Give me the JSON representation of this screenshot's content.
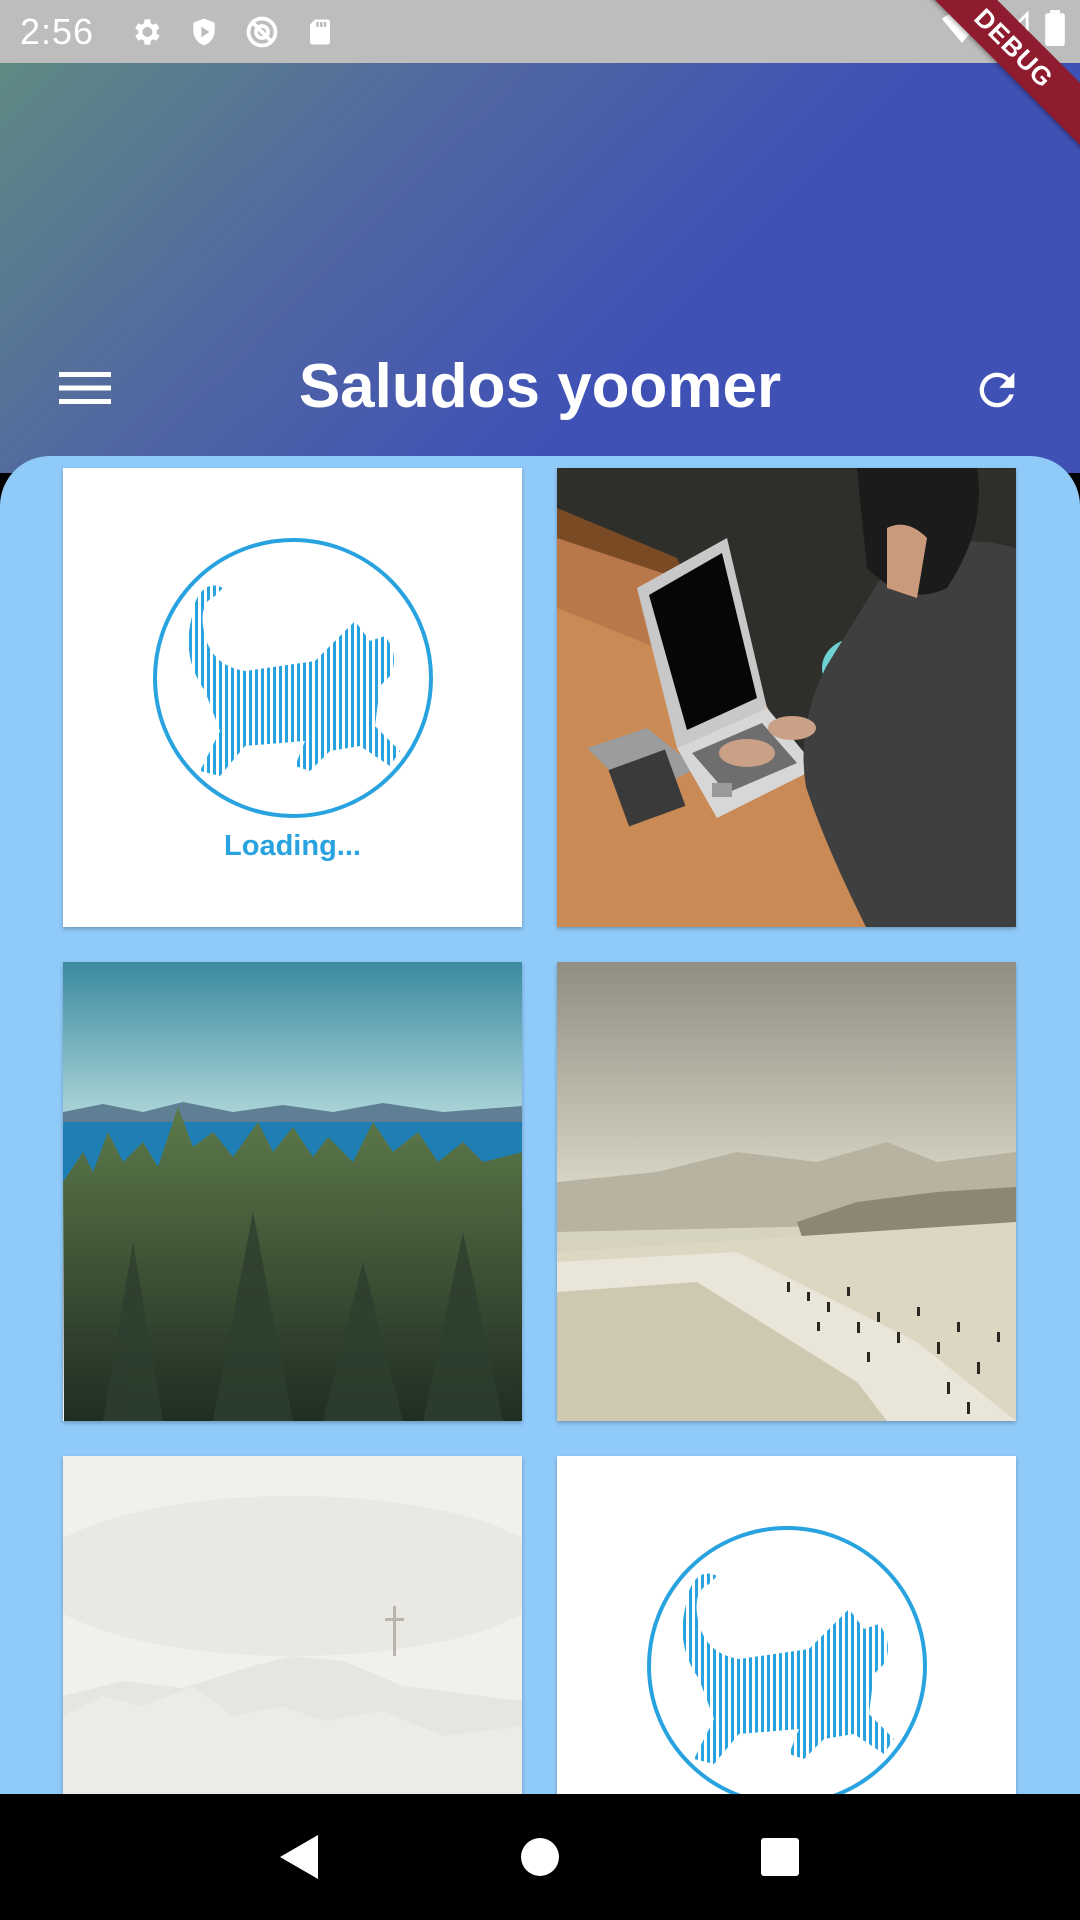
{
  "status_bar": {
    "time": "2:56",
    "icons": [
      "settings-icon",
      "shield-icon",
      "no-location-icon",
      "sd-card-icon"
    ],
    "right_icons": [
      "wifi-icon",
      "signal-icon",
      "battery-icon"
    ]
  },
  "debug_banner": {
    "label": "DEBUG",
    "color": "#8e1b2e"
  },
  "header": {
    "title": "Saludos yoomer",
    "menu_icon": "menu-icon",
    "refresh_icon": "refresh-icon",
    "gradient": [
      "#5f8a83",
      "#3f51b5"
    ]
  },
  "content": {
    "background": "#90caf9",
    "tiles": [
      {
        "kind": "placeholder",
        "image": "cat-loading-placeholder",
        "caption": "Loading..."
      },
      {
        "kind": "photo",
        "image": "person-with-laptop-photo"
      },
      {
        "kind": "photo",
        "image": "forest-and-lake-photo"
      },
      {
        "kind": "photo",
        "image": "beach-with-people-photo"
      },
      {
        "kind": "photo",
        "image": "snowy-mountain-with-cross-photo"
      },
      {
        "kind": "placeholder",
        "image": "cat-loading-placeholder"
      }
    ]
  },
  "nav_bar": {
    "buttons": [
      "back-icon",
      "home-icon",
      "recents-icon"
    ]
  }
}
